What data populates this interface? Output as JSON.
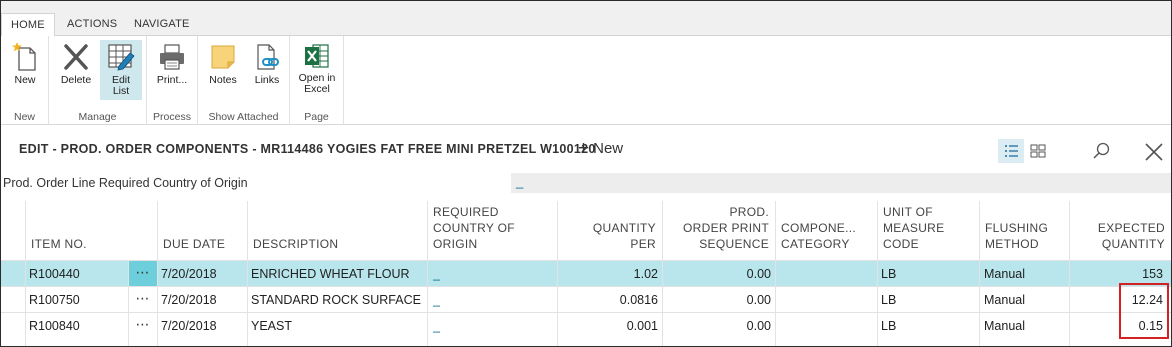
{
  "ribbon": {
    "tabs": [
      "HOME",
      "ACTIONS",
      "NAVIGATE"
    ],
    "groups": [
      {
        "label": "New",
        "buttons": [
          {
            "label": "New",
            "icon": "new-document-icon"
          }
        ]
      },
      {
        "label": "Manage",
        "buttons": [
          {
            "label": "Delete",
            "icon": "delete-x-icon"
          },
          {
            "label": "Edit List",
            "icon": "edit-list-icon",
            "selected": true
          }
        ]
      },
      {
        "label": "Process",
        "buttons": [
          {
            "label": "Print...",
            "icon": "printer-icon"
          }
        ]
      },
      {
        "label": "Show Attached",
        "buttons": [
          {
            "label": "Notes",
            "icon": "notes-icon"
          },
          {
            "label": "Links",
            "icon": "links-icon"
          }
        ]
      },
      {
        "label": "Page",
        "buttons": [
          {
            "label": "Open in Excel",
            "icon": "excel-icon"
          }
        ]
      }
    ],
    "edit_list_line1": "Edit",
    "edit_list_line2": "List",
    "excel_line1": "Open in",
    "excel_line2": "Excel"
  },
  "titlebar": {
    "title": "EDIT - PROD. ORDER COMPONENTS - MR114486 YOGIES FAT FREE MINI PRETZEL W100120",
    "new_label": "New",
    "new_plus": "+"
  },
  "field": {
    "label": "Prod. Order Line Required Country of Origin",
    "value": "_"
  },
  "grid": {
    "columns": [
      {
        "key": "item_no",
        "lines": [
          "ITEM NO."
        ]
      },
      {
        "key": "due_date",
        "lines": [
          "DUE DATE"
        ]
      },
      {
        "key": "description",
        "lines": [
          "DESCRIPTION"
        ]
      },
      {
        "key": "country",
        "lines": [
          "REQUIRED",
          "COUNTRY OF",
          "ORIGIN"
        ]
      },
      {
        "key": "qty_per",
        "lines": [
          "QUANTITY",
          "PER"
        ]
      },
      {
        "key": "print_seq",
        "lines": [
          "PROD.",
          "ORDER PRINT",
          "SEQUENCE"
        ]
      },
      {
        "key": "category",
        "lines": [
          "COMPONE...",
          "CATEGORY"
        ]
      },
      {
        "key": "uom",
        "lines": [
          "UNIT OF",
          "MEASURE",
          "CODE"
        ]
      },
      {
        "key": "flushing",
        "lines": [
          "FLUSHING",
          "METHOD"
        ]
      },
      {
        "key": "expected",
        "lines": [
          "EXPECTED",
          "QUANTITY"
        ]
      }
    ],
    "row_menu": "⋯",
    "rows": [
      {
        "item_no": "R100440",
        "due_date": "7/20/2018",
        "description": "ENRICHED WHEAT FLOUR",
        "country": "_",
        "qty_per": "1.02",
        "print_seq": "0.00",
        "category": "",
        "uom": "LB",
        "flushing": "Manual",
        "expected": "153",
        "selected": true
      },
      {
        "item_no": "R100750",
        "due_date": "7/20/2018",
        "description": "STANDARD ROCK SURFACE S",
        "country": "_",
        "qty_per": "0.0816",
        "print_seq": "0.00",
        "category": "",
        "uom": "LB",
        "flushing": "Manual",
        "expected": "12.24",
        "selected": false
      },
      {
        "item_no": "R100840",
        "due_date": "7/20/2018",
        "description": "YEAST",
        "country": "_",
        "qty_per": "0.001",
        "print_seq": "0.00",
        "category": "",
        "uom": "LB",
        "flushing": "Manual",
        "expected": "0.15",
        "selected": false
      }
    ]
  },
  "colors": {
    "selected_row": "#b9e6ec",
    "selected_menu": "#6dcfdc",
    "highlight_border": "#d32222",
    "link": "#0b6a8a"
  }
}
